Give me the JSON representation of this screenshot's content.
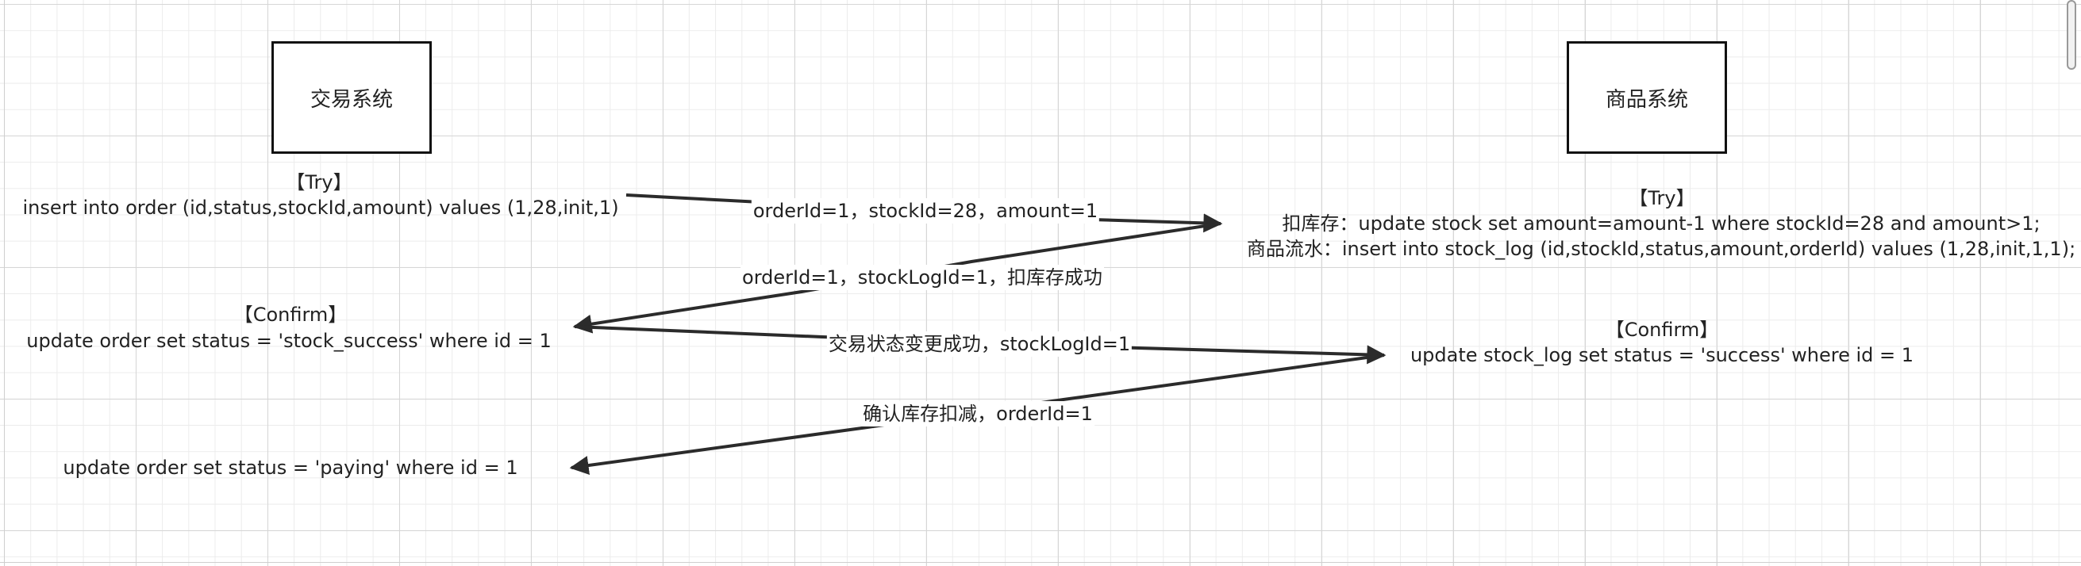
{
  "systems": {
    "trade": "交易系统",
    "goods": "商品系统"
  },
  "trade_try": {
    "tag": "【Try】",
    "sql": "insert into order (id,status,stockId,amount) values (1,28,init,1)"
  },
  "trade_confirm": {
    "tag": "【Confirm】",
    "sql": "update order set status = 'stock_success' where id = 1"
  },
  "trade_final": {
    "sql": "update order set status = 'paying' where id = 1"
  },
  "goods_try": {
    "tag": "【Try】",
    "line1": "扣库存：update stock set amount=amount-1 where stockId=28 and amount>1;",
    "line2": "商品流水：insert into stock_log (id,stockId,status,amount,orderId) values (1,28,init,1,1);"
  },
  "goods_confirm": {
    "tag": "【Confirm】",
    "sql": "update stock_log set status = 'success' where id = 1"
  },
  "messages": {
    "m1": "orderId=1，stockId=28，amount=1",
    "m2": "orderId=1，stockLogId=1，扣库存成功",
    "m3": "交易状态变更成功，stockLogId=1",
    "m4": "确认库存扣减，orderId=1"
  },
  "colors": {
    "arrow": "#2b2b2b",
    "box_border": "#111111",
    "grid_major": "#d6d6d6",
    "grid_minor": "#ececec"
  }
}
